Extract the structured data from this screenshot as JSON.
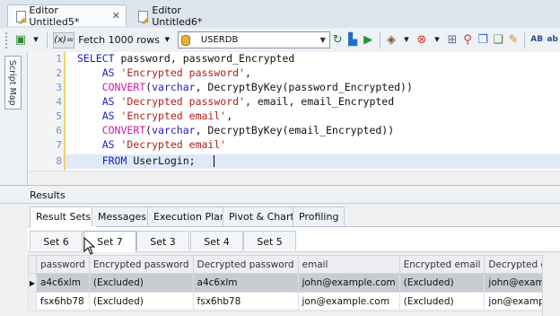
{
  "tabs": [
    {
      "label": "Editor Untitled5*",
      "active": true
    },
    {
      "label": "Editor Untitled6*",
      "active": false
    }
  ],
  "toolbar": {
    "fetch_label": "Fetch 1000 rows",
    "database": "USERDB",
    "expr_icon": "(x)="
  },
  "sidebar": {
    "script_map_label": "Script Map"
  },
  "editor": {
    "line_numbers": [
      "1",
      "2",
      "3",
      "4",
      "5",
      "6",
      "7",
      "8"
    ],
    "current_line": 8,
    "lines": [
      "SELECT password, password_Encrypted",
      "    AS 'Encrypted password',",
      "    CONVERT(varchar, DecryptByKey(password_Encrypted))",
      "    AS 'Decrypted password', email, email_Encrypted",
      "    AS 'Encrypted email',",
      "    CONVERT(varchar, DecryptByKey(email_Encrypted))",
      "    AS 'Decrypted email'",
      "    FROM UserLogin;"
    ]
  },
  "results": {
    "title": "Results",
    "tabs": [
      "Result Sets",
      "Messages",
      "Execution Plan",
      "Pivot & Chart",
      "Profiling"
    ],
    "active_tab": "Result Sets",
    "sets": [
      "Set 6",
      "Set 7",
      "Set 3",
      "Set 4",
      "Set 5"
    ],
    "active_set": "Set 7",
    "grid": {
      "columns": [
        "password",
        "Encrypted password",
        "Decrypted password",
        "email",
        "Encrypted email",
        "Decrypted email"
      ],
      "rows": [
        [
          "a4c6xlm",
          "(Excluded)",
          "a4c6xlm",
          "john@example.com",
          "(Excluded)",
          "john@example.com"
        ],
        [
          "fsx6hb78",
          "(Excluded)",
          "fsx6hb78",
          "jon@example.com",
          "(Excluded)",
          "jon@example.com"
        ]
      ],
      "selected_row": 0
    }
  },
  "colors": {
    "keyword": "#1c1cc8",
    "string": "#b0201d",
    "function": "#cc1aa8",
    "line_number": "#6a8ec6",
    "current_line_bg": "#dfe9f7"
  }
}
